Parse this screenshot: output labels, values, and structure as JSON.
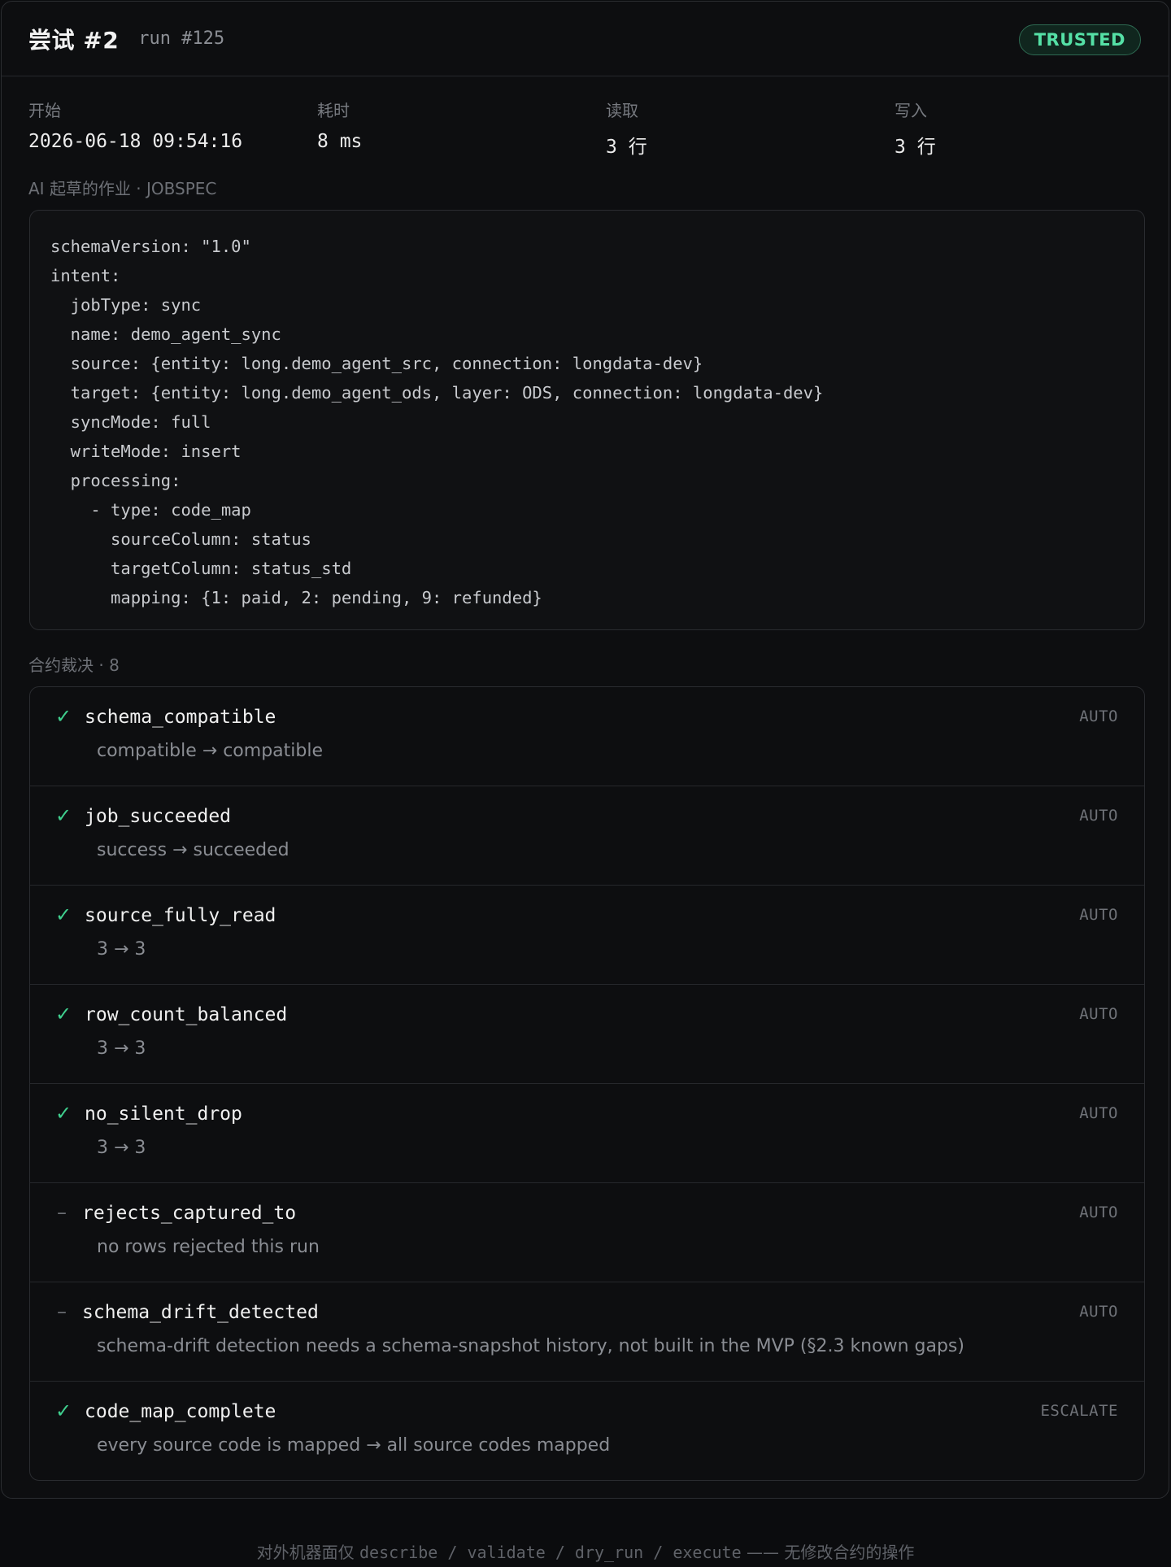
{
  "header": {
    "attempt_title": "尝试 #2",
    "run_id": "run #125",
    "badge": "TRUSTED"
  },
  "stats": [
    {
      "label": "开始",
      "value": "2026-06-18 09:54:16"
    },
    {
      "label": "耗时",
      "value": "8 ms"
    },
    {
      "label": "读取",
      "value": "3 行"
    },
    {
      "label": "写入",
      "value": "3 行"
    }
  ],
  "jobspec": {
    "section_label": "AI 起草的作业 · JOBSPEC",
    "yaml": "schemaVersion: \"1.0\"\nintent:\n  jobType: sync\n  name: demo_agent_sync\n  source: {entity: long.demo_agent_src, connection: longdata-dev}\n  target: {entity: long.demo_agent_ods, layer: ODS, connection: longdata-dev}\n  syncMode: full\n  writeMode: insert\n  processing:\n    - type: code_map\n      sourceColumn: status\n      targetColumn: status_std\n      mapping: {1: paid, 2: pending, 9: refunded}"
  },
  "verdicts": {
    "section_label": "合约裁决 · 8",
    "items": [
      {
        "status": "✓",
        "name": "schema_compatible",
        "detail": "compatible → compatible",
        "mode": "AUTO"
      },
      {
        "status": "✓",
        "name": "job_succeeded",
        "detail": "success → succeeded",
        "mode": "AUTO"
      },
      {
        "status": "✓",
        "name": "source_fully_read",
        "detail": "3 → 3",
        "mode": "AUTO"
      },
      {
        "status": "✓",
        "name": "row_count_balanced",
        "detail": "3 → 3",
        "mode": "AUTO"
      },
      {
        "status": "✓",
        "name": "no_silent_drop",
        "detail": "3 → 3",
        "mode": "AUTO"
      },
      {
        "status": "–",
        "name": "rejects_captured_to",
        "detail": "no rows rejected this run",
        "mode": "AUTO"
      },
      {
        "status": "–",
        "name": "schema_drift_detected",
        "detail": "schema-drift detection needs a schema-snapshot history, not built in the MVP (§2.3 known gaps)",
        "mode": "AUTO"
      },
      {
        "status": "✓",
        "name": "code_map_complete",
        "detail": "every source code is mapped → all source codes mapped",
        "mode": "ESCALATE"
      }
    ]
  },
  "footer": {
    "prefix": "对外机器面仅 ",
    "ops": "describe / validate / dry_run / execute",
    "suffix": " —— 无修改合约的操作"
  },
  "colors": {
    "background": "#0b0c0e",
    "pass": "#3fcf8e",
    "trusted_badge": "#55e0a6"
  }
}
